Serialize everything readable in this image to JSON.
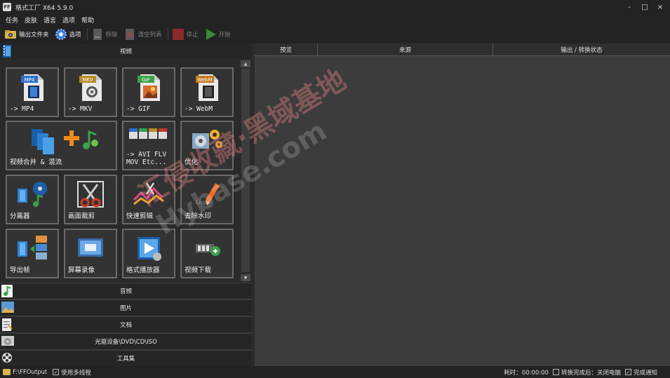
{
  "window": {
    "title": "格式工厂 X64 5.9.0",
    "app_icon": "format-factory-icon",
    "controls": {
      "minimize": "-",
      "maximize": "□",
      "close": "×"
    }
  },
  "menu": [
    "任务",
    "皮肤",
    "语言",
    "选项",
    "帮助"
  ],
  "toolbar": {
    "output_folder": "输出文件夹",
    "options": "选项",
    "remove": "移除",
    "clear_list": "清空列表",
    "stop": "停止",
    "start": "开始"
  },
  "categories": {
    "video": "视频",
    "audio": "音频",
    "image": "图片",
    "document": "文档",
    "rom": "光驱设备\\DVD\\CD\\ISO",
    "tools": "工具集"
  },
  "tiles": [
    {
      "label": "-> MP4",
      "badge": "MP4",
      "badge_color": "#2f6fc9",
      "icon": "mp4-file-icon"
    },
    {
      "label": "-> MKV",
      "badge": "MKV",
      "badge_color": "#b88a2a",
      "icon": "mkv-file-icon"
    },
    {
      "label": "-> GIF",
      "badge": "GIF",
      "badge_color": "#3aa24a",
      "icon": "gif-file-icon"
    },
    {
      "label": "-> WebM",
      "badge": "WebM",
      "badge_color": "#c07a20",
      "icon": "webm-file-icon"
    },
    {
      "label": "视频合并 & 混流",
      "icon": "video-merge-icon"
    },
    {
      "label": "-> AVI FLV\nMOV Etc...",
      "icon": "other-formats-icon"
    },
    {
      "label": "优化",
      "icon": "optimize-icon"
    },
    {
      "label": "分离器",
      "icon": "demuxer-icon"
    },
    {
      "label": "画面裁剪",
      "icon": "crop-icon"
    },
    {
      "label": "快速剪辑",
      "icon": "quick-clip-icon"
    },
    {
      "label": "去除水印",
      "icon": "remove-watermark-icon"
    },
    {
      "label": "导出帧",
      "icon": "export-frames-icon"
    },
    {
      "label": "屏幕录像",
      "icon": "screen-record-icon"
    },
    {
      "label": "格式播放器",
      "icon": "player-icon"
    },
    {
      "label": "视频下载",
      "icon": "video-download-icon"
    }
  ],
  "columns": [
    "预览",
    "来源",
    "输出 / 转换状态"
  ],
  "status": {
    "output_path": "F:\\FFOutput",
    "multithread": "使用多线程",
    "elapsed": "耗时：00:00:00",
    "after_convert": "转换完成后：关闭电脑",
    "notify": "完成通知"
  },
  "watermark": {
    "text_cn": "汇侵收藏·黑域基地",
    "text_en": "Hybase.com"
  },
  "colors": {
    "accent_green": "#3aa24a",
    "stop_red": "#c0392b",
    "folder_yellow": "#d8b24a"
  }
}
